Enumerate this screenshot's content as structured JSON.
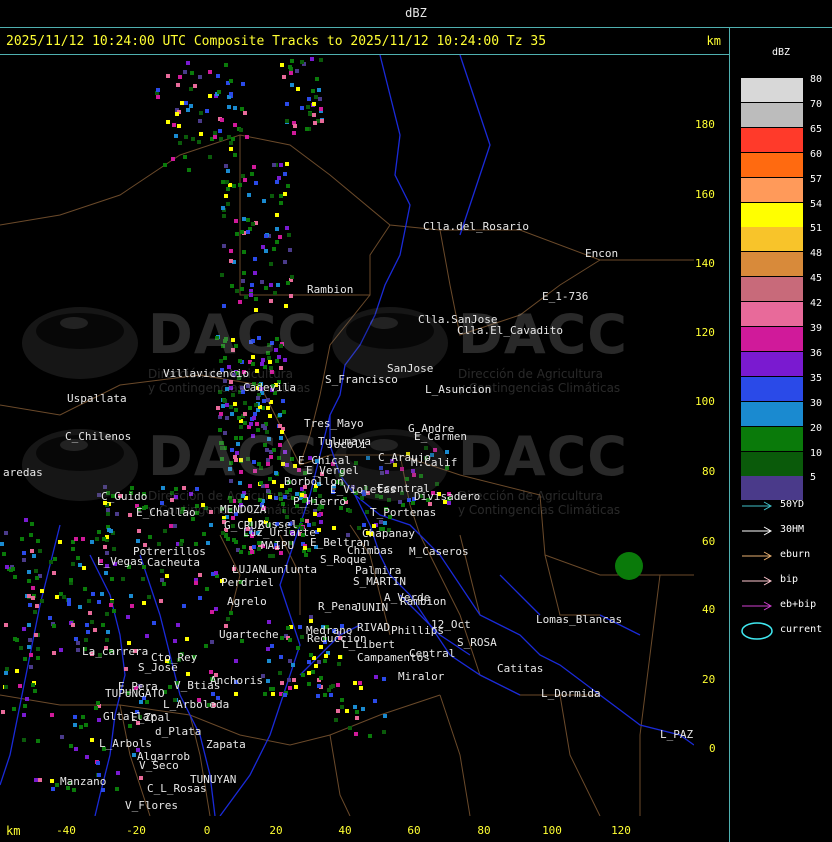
{
  "window": {
    "title": "dBZ"
  },
  "header": {
    "caption": "2025/11/12 10:24:00 UTC Composite Tracks to 2025/11/12 10:24:00 Tz 35",
    "unit": "km"
  },
  "axes": {
    "x_unit": "km",
    "x_ticks": [
      "-40",
      "-20",
      "0",
      "20",
      "40",
      "60",
      "80",
      "100",
      "120"
    ],
    "y_ticks": [
      "180",
      "160",
      "140",
      "120",
      "100",
      "80",
      "60",
      "40",
      "20",
      "0"
    ]
  },
  "legend": {
    "title": "dBZ",
    "levels": [
      {
        "label": "80",
        "color": "#d8d8d8"
      },
      {
        "label": "70",
        "color": "#bcbcbc"
      },
      {
        "label": "65",
        "color": "#ff3a2a"
      },
      {
        "label": "60",
        "color": "#ff6a10"
      },
      {
        "label": "57",
        "color": "#ff9a5a"
      },
      {
        "label": "54",
        "color": "#ffff00"
      },
      {
        "label": "51",
        "color": "#f8c42a"
      },
      {
        "label": "48",
        "color": "#d88a3a"
      },
      {
        "label": "45",
        "color": "#c86a7a"
      },
      {
        "label": "42",
        "color": "#e86a9a"
      },
      {
        "label": "39",
        "color": "#d01a9a"
      },
      {
        "label": "36",
        "color": "#7a1ad0"
      },
      {
        "label": "35",
        "color": "#2a4ae8"
      },
      {
        "label": "30",
        "color": "#1a8ad0"
      },
      {
        "label": "20",
        "color": "#0a7a0a"
      },
      {
        "label": "10",
        "color": "#0a5a0a"
      },
      {
        "label": "5",
        "color": "#4a3a8a"
      }
    ],
    "tracks": [
      {
        "label": "50YD",
        "color": "#40c0c8"
      },
      {
        "label": "30HM",
        "color": "#ffffff"
      },
      {
        "label": "eburn",
        "color": "#e8b070"
      },
      {
        "label": "bip",
        "color": "#ffc8d0"
      },
      {
        "label": "eb+bip",
        "color": "#d040d0"
      }
    ],
    "current": {
      "label": "current",
      "color": "#40e8f0"
    }
  },
  "watermark": {
    "brand": "DACC",
    "subtitle_line1": "Dirección de Agricultura",
    "subtitle_line2": "y Contingencias Climáticas"
  },
  "places": [
    {
      "name": "Clla.del_Rosario"
    },
    {
      "name": "Encon"
    },
    {
      "name": "E_1-736"
    },
    {
      "name": "Rambion"
    },
    {
      "name": "Clla.SanJose"
    },
    {
      "name": "Clla.El_Cavadito"
    },
    {
      "name": "Villavicencio"
    },
    {
      "name": "S_Francisco"
    },
    {
      "name": "SanJose"
    },
    {
      "name": "L_Asuncion"
    },
    {
      "name": "Uspallata"
    },
    {
      "name": "Cadevila"
    },
    {
      "name": "Tres_Mayo"
    },
    {
      "name": "G_Andre"
    },
    {
      "name": "C_Chilenos"
    },
    {
      "name": "Tulumaya"
    },
    {
      "name": "E_Carmen"
    },
    {
      "name": "E_Chical"
    },
    {
      "name": "C_Araujo"
    },
    {
      "name": "E_Vergel"
    },
    {
      "name": "M.Calif"
    },
    {
      "name": "Borbollon"
    },
    {
      "name": "E_Violetas"
    },
    {
      "name": "Ecentral"
    },
    {
      "name": "Divisadero"
    },
    {
      "name": "C_Guido"
    },
    {
      "name": "P_Hierro"
    },
    {
      "name": "E_Challao"
    },
    {
      "name": "MENDOZA"
    },
    {
      "name": "T_Portenas"
    },
    {
      "name": "G_CRUZ"
    },
    {
      "name": "Chapanay"
    },
    {
      "name": "E_Beltran"
    },
    {
      "name": "Potrerillos"
    },
    {
      "name": "Chimbas"
    },
    {
      "name": "M_Caseros"
    },
    {
      "name": "L_Vegas"
    },
    {
      "name": "Cacheuta"
    },
    {
      "name": "S_Roque"
    },
    {
      "name": "Palmira"
    },
    {
      "name": "Perdriel"
    },
    {
      "name": "S_MARTIN"
    },
    {
      "name": "A_Verde"
    },
    {
      "name": "Rambion"
    },
    {
      "name": "Agrelo"
    },
    {
      "name": "R_Pena"
    },
    {
      "name": "JUNIN"
    },
    {
      "name": "Lomas_Blancas"
    },
    {
      "name": "12_Oct"
    },
    {
      "name": "Ugarteche"
    },
    {
      "name": "RIVAD"
    },
    {
      "name": "Phillips"
    },
    {
      "name": "Reduccion"
    },
    {
      "name": "S_ROSA"
    },
    {
      "name": "Medrano"
    },
    {
      "name": "L_Libert"
    },
    {
      "name": "La_carrera"
    },
    {
      "name": "Cto_Rey"
    },
    {
      "name": "Campamentos"
    },
    {
      "name": "Central"
    },
    {
      "name": "Catitas"
    },
    {
      "name": "S_Jose"
    },
    {
      "name": "Anchoris"
    },
    {
      "name": "E_Pera"
    },
    {
      "name": "V_Btias"
    },
    {
      "name": "Miralor"
    },
    {
      "name": "TUPUNGATO"
    },
    {
      "name": "L_Dormida"
    },
    {
      "name": "L_Arboleda"
    },
    {
      "name": "Gltallar"
    },
    {
      "name": "E_Zpal"
    },
    {
      "name": "L_PAZ"
    },
    {
      "name": "d_Plata"
    },
    {
      "name": "L_Arbols"
    },
    {
      "name": "Zapata"
    },
    {
      "name": "Algarrob"
    },
    {
      "name": "V_Seco"
    },
    {
      "name": "Manzano"
    },
    {
      "name": "TUNUYAN"
    },
    {
      "name": "C_L_Rosas"
    },
    {
      "name": "V_Flores"
    },
    {
      "name": "aredas"
    },
    {
      "name": "LUJAN"
    },
    {
      "name": "Russel"
    },
    {
      "name": "Jocoli"
    },
    {
      "name": "Lunlunta"
    },
    {
      "name": "MAIPU"
    },
    {
      "name": "Luz_Uriarte"
    }
  ]
}
